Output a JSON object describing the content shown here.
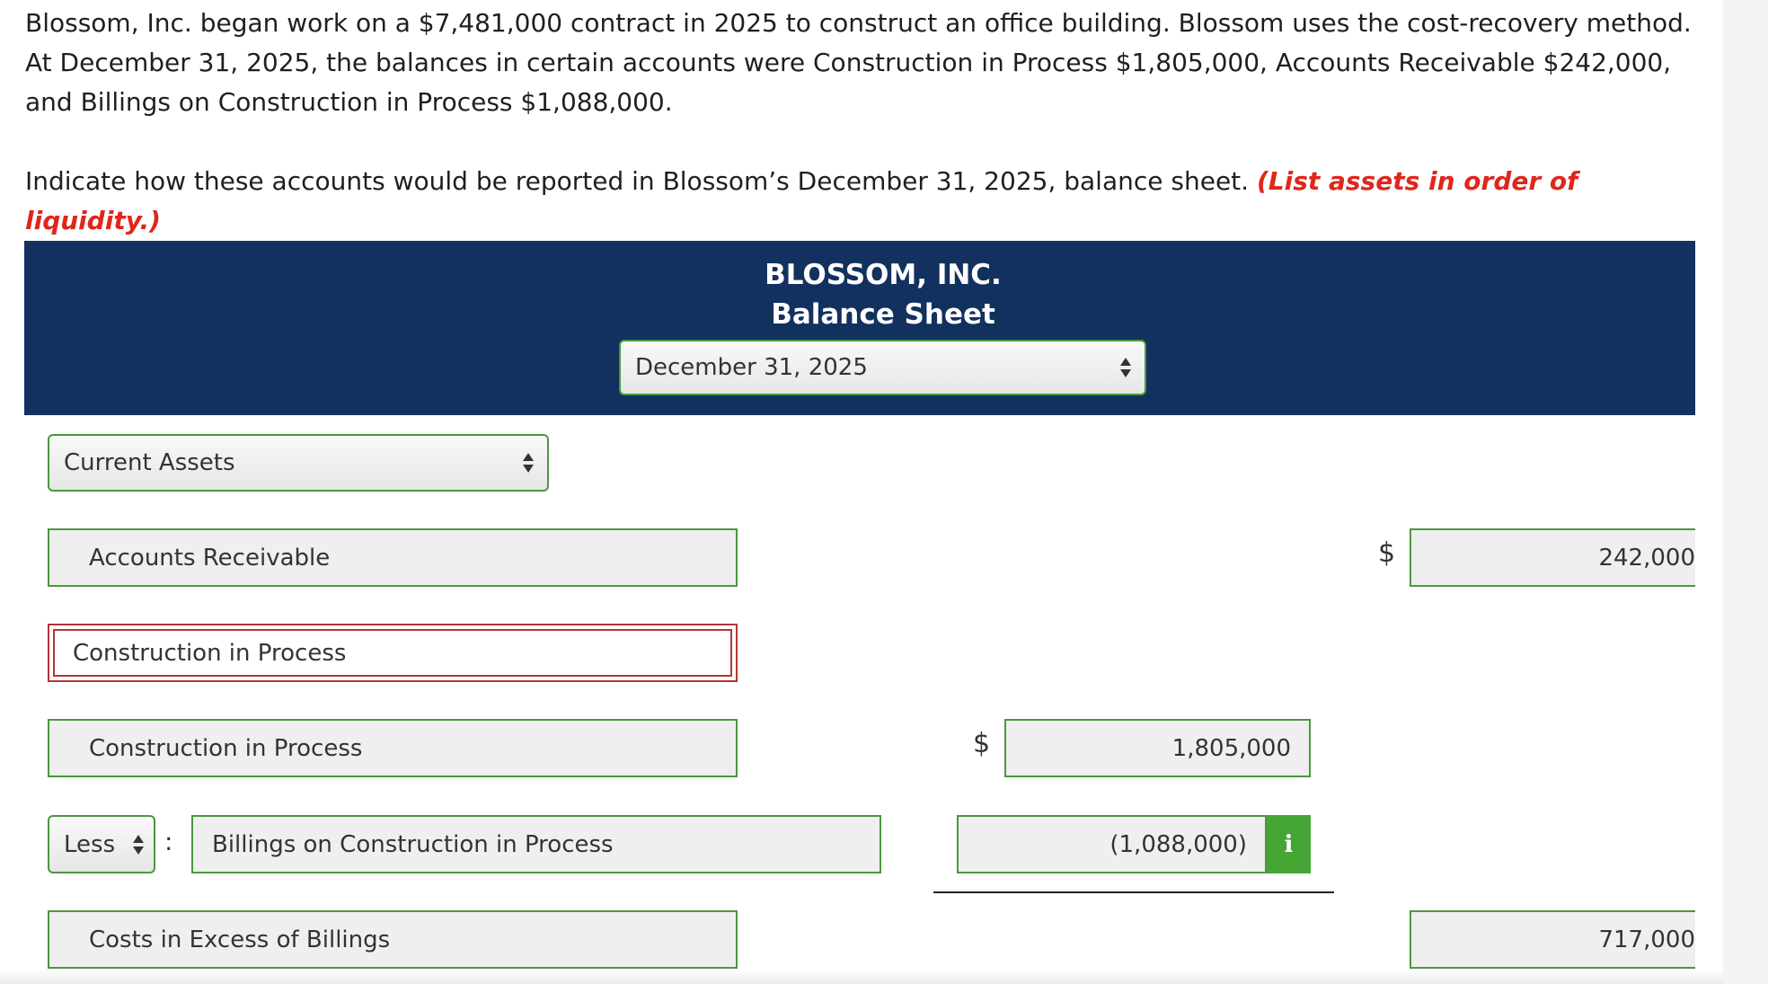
{
  "problem": {
    "paragraph_1": "Blossom, Inc. began work on a $7,481,000 contract in 2025 to construct an office building. Blossom uses the cost-recovery method. At December 31, 2025, the balances in certain accounts were Construction in Process $1,805,000, Accounts Receivable $242,000, and Billings on Construction in Process $1,088,000.",
    "instruction": "Indicate how these accounts would be reported in Blossom’s December 31, 2025, balance sheet.",
    "hint": "(List assets in order of liquidity.)"
  },
  "header": {
    "company": "BLOSSOM, INC.",
    "statement": "Balance Sheet",
    "date_select": "December 31, 2025"
  },
  "sheet": {
    "section_select": "Current Assets",
    "currency_symbol": "$",
    "rows": {
      "accounts_receivable": {
        "label": "Accounts Receivable",
        "amount": "242,000"
      },
      "cip_heading": {
        "label": "Construction in Process"
      },
      "cip": {
        "label": "Construction in Process",
        "amount": "1,805,000"
      },
      "billings": {
        "operator": "Less",
        "separator": ":",
        "label": "Billings on Construction in Process",
        "amount": "(1,088,000)"
      },
      "costs_in_excess": {
        "label": "Costs in Excess of Billings",
        "amount": "717,000"
      }
    },
    "info_icon": "info-icon"
  },
  "colors": {
    "header_background": "#13315e",
    "field_border": "#4c9740",
    "error_border": "#b33535",
    "hint_text": "#e0261b",
    "info_button": "#44a534"
  }
}
